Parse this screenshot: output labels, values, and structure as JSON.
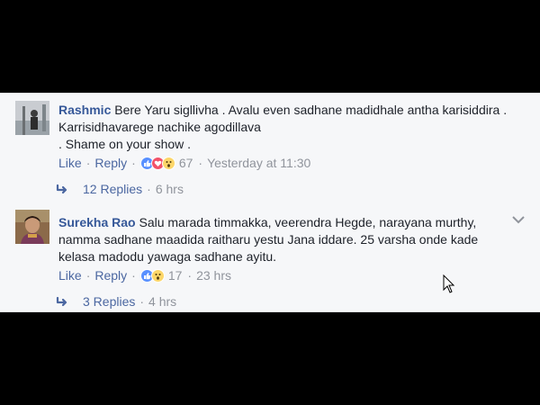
{
  "comments": [
    {
      "author": "Rashmic",
      "text": "Bere Yaru sigllivha . Avalu even sadhane madidhale antha karisiddira . Karrisidhavarege nachike agodillava",
      "text_line2": ". Shame on your show .",
      "like_label": "Like",
      "reply_label": "Reply",
      "reaction_count": "67",
      "timestamp": "Yesterday at 11:30",
      "reactions": [
        "like",
        "love",
        "wow"
      ],
      "replies_label": "12 Replies",
      "replies_time": "6 hrs"
    },
    {
      "author": "Surekha Rao",
      "text": "Salu marada timmakka, veerendra Hegde, narayana murthy, namma sadhane maadida raitharu yestu Jana iddare. 25 varsha onde kade kelasa madodu yawaga sadhane ayitu.",
      "like_label": "Like",
      "reply_label": "Reply",
      "reaction_count": "17",
      "timestamp": "23 hrs",
      "reactions": [
        "like",
        "wow"
      ],
      "replies_label": "3 Replies",
      "replies_time": "4 hrs"
    }
  ],
  "colors": {
    "link": "#4b67a1",
    "author": "#365899",
    "meta": "#90949c",
    "background": "#f6f7f9"
  }
}
